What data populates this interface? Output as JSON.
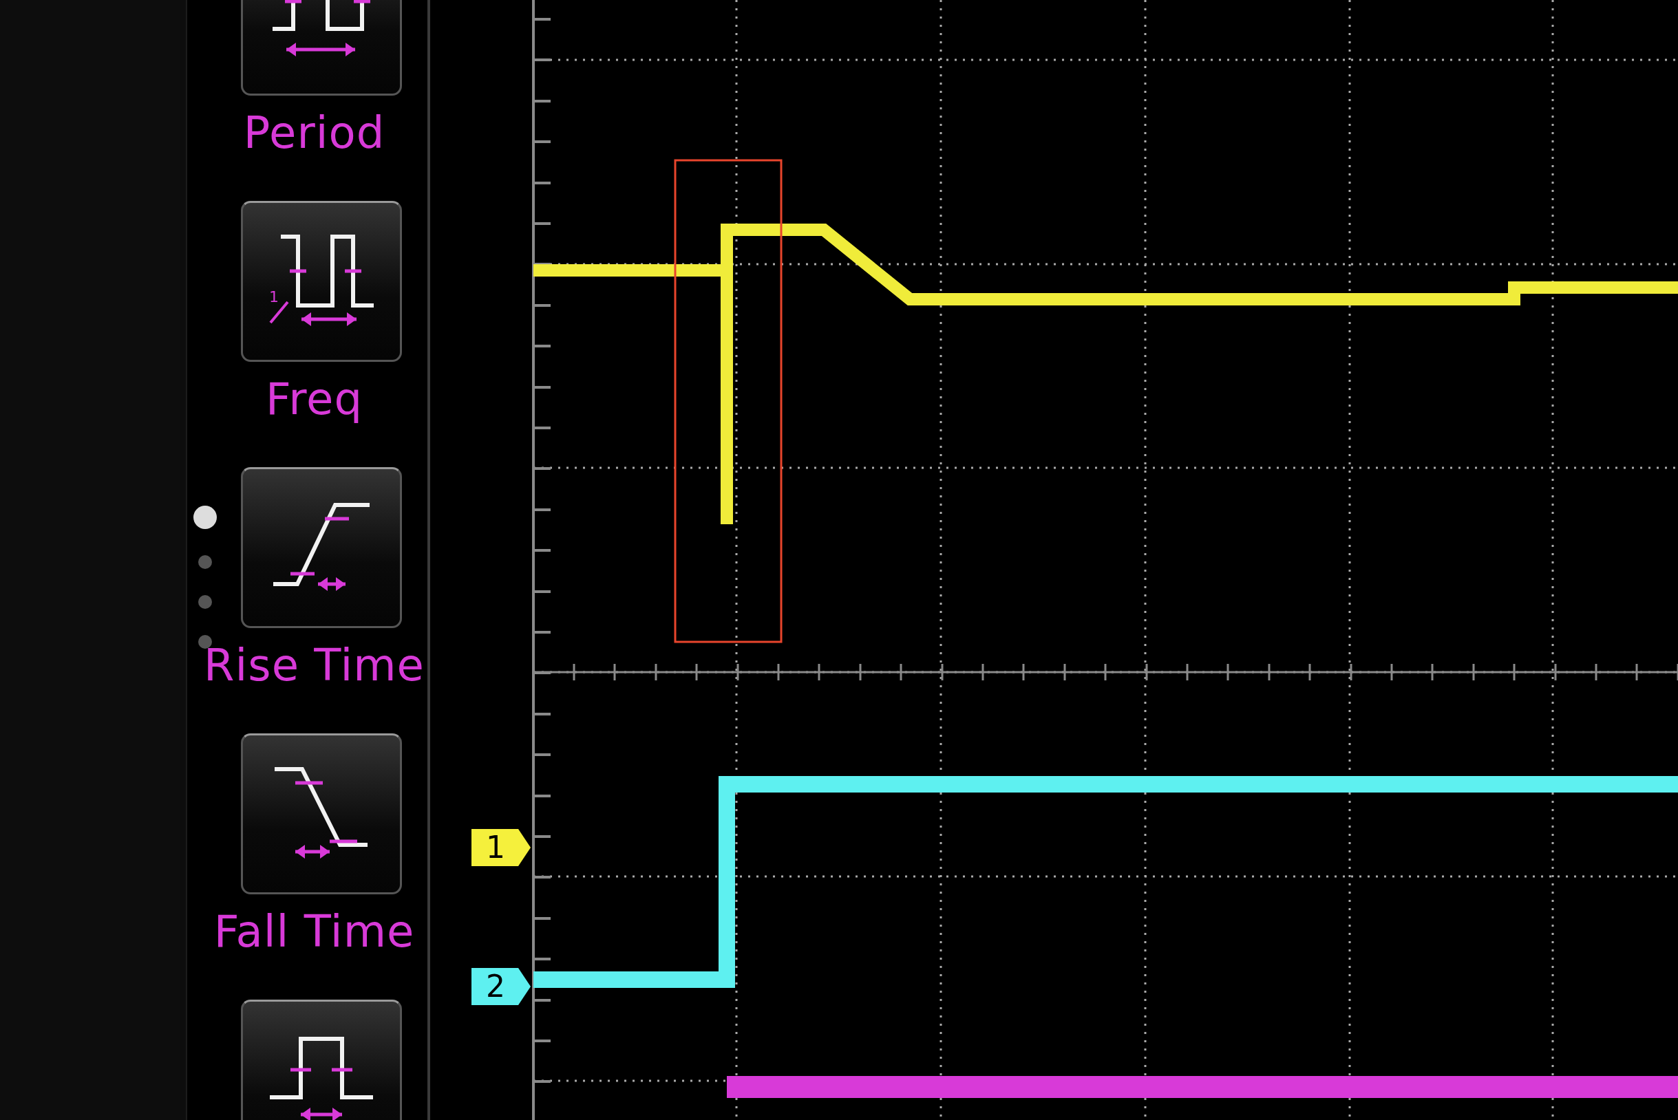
{
  "measurements": [
    {
      "kind": "period",
      "label": "Period"
    },
    {
      "kind": "freq",
      "label": "Freq",
      "icon_text": "1"
    },
    {
      "kind": "rise",
      "label": "Rise Time"
    },
    {
      "kind": "fall",
      "label": "Fall Time"
    },
    {
      "kind": "width"
    }
  ],
  "pager": [
    {
      "selected": true
    },
    {
      "selected": false
    },
    {
      "selected": false
    },
    {
      "selected": false
    }
  ],
  "channel_markers": [
    {
      "label": "1",
      "color": "#f5f03c"
    },
    {
      "label": "2",
      "color": "#5ef0f0"
    }
  ]
}
